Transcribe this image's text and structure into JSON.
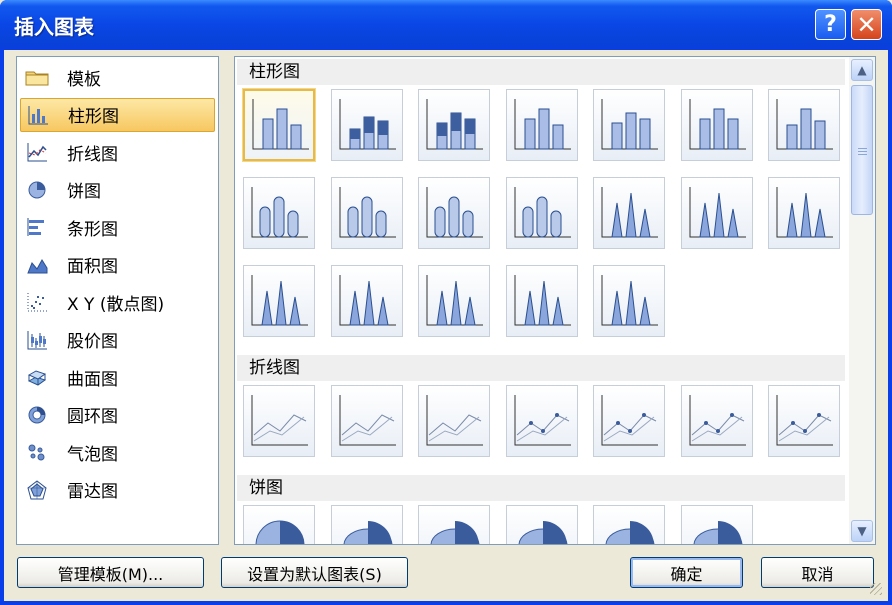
{
  "window": {
    "title": "插入图表"
  },
  "titlebar": {
    "help_icon": "?",
    "close_icon": "✕"
  },
  "categories": [
    {
      "label": "模板",
      "icon": "folder-icon"
    },
    {
      "label": "柱形图",
      "icon": "column-chart-icon",
      "selected": true
    },
    {
      "label": "折线图",
      "icon": "line-chart-icon"
    },
    {
      "label": "饼图",
      "icon": "pie-chart-icon"
    },
    {
      "label": "条形图",
      "icon": "bar-chart-icon"
    },
    {
      "label": "面积图",
      "icon": "area-chart-icon"
    },
    {
      "label": "X Y (散点图)",
      "icon": "scatter-chart-icon"
    },
    {
      "label": "股价图",
      "icon": "stock-chart-icon"
    },
    {
      "label": "曲面图",
      "icon": "surface-chart-icon"
    },
    {
      "label": "圆环图",
      "icon": "doughnut-chart-icon"
    },
    {
      "label": "气泡图",
      "icon": "bubble-chart-icon"
    },
    {
      "label": "雷达图",
      "icon": "radar-chart-icon"
    }
  ],
  "gallery": {
    "sections": [
      {
        "title": "柱形图",
        "count": 19
      },
      {
        "title": "折线图",
        "count": 7
      },
      {
        "title": "饼图",
        "count": 6
      }
    ]
  },
  "scrollbar": {
    "up_icon": "▲",
    "down_icon": "▼"
  },
  "buttons": {
    "manage_templates": "管理模板(M)...",
    "set_default": "设置为默认图表(S)",
    "ok": "确定",
    "cancel": "取消"
  }
}
